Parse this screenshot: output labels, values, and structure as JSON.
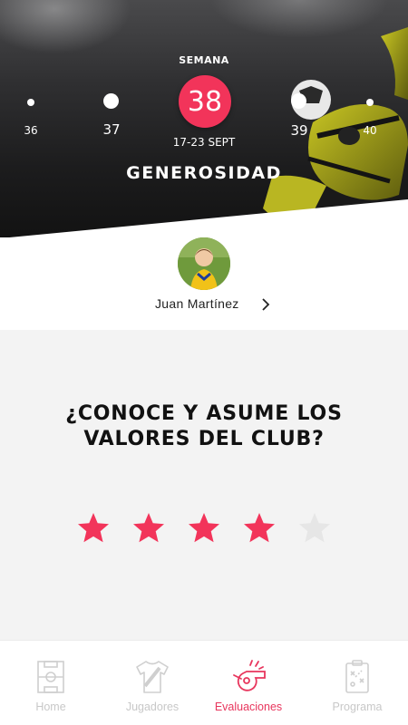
{
  "week": {
    "label": "SEMANA",
    "current": "38",
    "dates": "17-23 SEPT",
    "prev2": "36",
    "prev1": "37",
    "next1": "39",
    "next2": "40"
  },
  "value_title": "GENEROSIDAD",
  "player": {
    "name": "Juan Martínez"
  },
  "question": {
    "line1": "¿CONOCE Y ASUME LOS",
    "line2": "VALORES DEL CLUB?"
  },
  "rating": {
    "value": 4,
    "max": 5
  },
  "colors": {
    "accent": "#f2345a",
    "star_active": "#f2345a",
    "star_inactive": "#e6e6e6",
    "tab_inactive": "#c8c8c8",
    "tab_active": "#e8365d"
  },
  "tabs": [
    {
      "label": "Home",
      "icon": "field-icon"
    },
    {
      "label": "Jugadores",
      "icon": "jersey-icon"
    },
    {
      "label": "Evaluaciones",
      "icon": "whistle-icon"
    },
    {
      "label": "Programa",
      "icon": "tactics-board-icon"
    }
  ],
  "active_tab": "Evaluaciones"
}
